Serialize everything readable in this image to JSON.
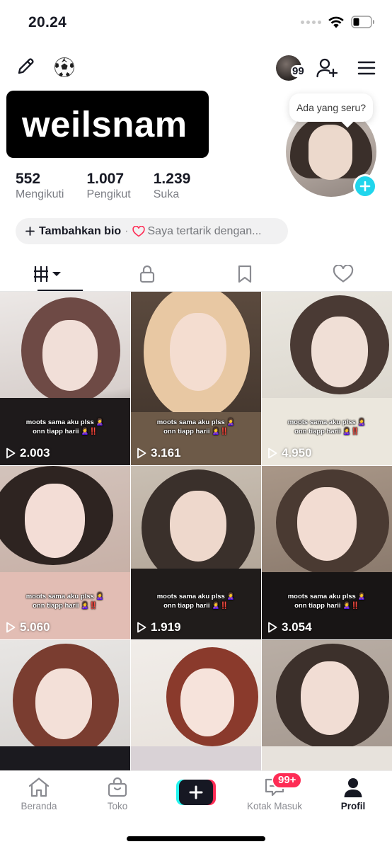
{
  "status_bar": {
    "time": "20.24"
  },
  "header": {
    "notification_count": "99",
    "icons": [
      "pencil-icon",
      "soccer-ball-icon",
      "add-friend-icon",
      "menu-icon"
    ]
  },
  "profile": {
    "username": "weilsnam",
    "bubble_text": "Ada yang seru?",
    "stats": [
      {
        "value": "552",
        "label": "Mengikuti"
      },
      {
        "value": "1.007",
        "label": "Pengikut"
      },
      {
        "value": "1.239",
        "label": "Suka"
      }
    ],
    "bio": {
      "add_label": "Tambahkan bio",
      "separator": "·",
      "interest_label": "Saya tertarik dengan..."
    }
  },
  "tabs": [
    "videos-tab",
    "private-tab",
    "bookmarks-tab",
    "liked-tab"
  ],
  "videos": [
    {
      "views": "2.003",
      "caption_line1": "moots sama aku plss 🙎‍♀️",
      "caption_line2": "onn tiapp harii 🙎‍♀️‼️"
    },
    {
      "views": "3.161",
      "caption_line1": "moots sama aku plss 🙎‍♀️",
      "caption_line2": "onn tiapp harii 🙎‍♀️‼️"
    },
    {
      "views": "4.950",
      "caption_line1": "moots sama aku plss 🙎‍♀️",
      "caption_line2": "onn tiapp harii 🙎‍♀️‼️"
    },
    {
      "views": "5.060",
      "caption_line1": "moots sama aku plss 🙎‍♀️",
      "caption_line2": "onn tiapp harii 🙎‍♀️‼️"
    },
    {
      "views": "1.919",
      "caption_line1": "moots sama aku plss 🙎‍♀️",
      "caption_line2": "onn tiapp harii 🙎‍♀️‼️"
    },
    {
      "views": "3.054",
      "caption_line1": "moots sama aku plss 🙎‍♀️",
      "caption_line2": "onn tiapp harii 🙎‍♀️‼️"
    },
    {
      "views": "",
      "caption_line1": "",
      "caption_line2": ""
    },
    {
      "views": "",
      "caption_line1": "",
      "caption_line2": ""
    },
    {
      "views": "",
      "caption_line1": "",
      "caption_line2": ""
    }
  ],
  "bottom_nav": {
    "home": "Beranda",
    "shop": "Toko",
    "inbox": "Kotak Masuk",
    "inbox_badge": "99+",
    "profile": "Profil"
  },
  "colors": {
    "accent_red": "#fe2c55",
    "accent_cyan": "#25f4ee",
    "add_button": "#20d5ec",
    "text_primary": "#161823"
  }
}
